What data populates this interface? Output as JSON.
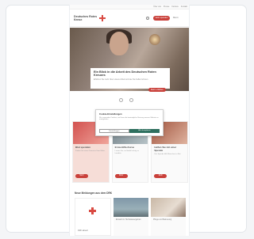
{
  "topnav": [
    "Über uns",
    "Presse",
    "Karriere",
    "Kontakt"
  ],
  "header": {
    "logo_title": "Deutsches Rotes Kreuz",
    "logo_sub": "Mein DRK",
    "donate_label": "Jetzt spenden",
    "menu_label": "Menü"
  },
  "hero": {
    "title": "Ein Blick in die Arbeit des Deutschen Roten Kreuzes",
    "text": "Erfahren Sie mehr über unsere Arbeit und wie Sie helfen können.",
    "button": "Mehr erfahren"
  },
  "cards": [
    {
      "title": "Blut spenden",
      "text": "Finden Sie einen Termin in Ihrer Nähe.",
      "button": "Mehr"
    },
    {
      "title": "Erste-Hilfe-Kurse",
      "text": "Lernen Sie, im Notfall richtig zu handeln.",
      "button": "Mehr"
    },
    {
      "title": "Helfen Sie mit einer Spende",
      "text": "Ihre Spende hilft Menschen in Not.",
      "button": "Mehr"
    }
  ],
  "cookie": {
    "title": "Cookie-Einstellungen",
    "text": "Wir verwenden Cookies, um Ihnen die bestmögliche Nutzung unserer Website zu ermöglichen.",
    "settings": "Einstellungen",
    "accept": "Alle akzeptieren"
  },
  "section": {
    "title": "Neue Meldungen aus dem DRK",
    "items": [
      {
        "text": "DRK aktuell"
      },
      {
        "text": "Einsatz im Hochwassergebiet"
      },
      {
        "text": "Pflege und Betreuung"
      }
    ]
  },
  "colors": {
    "brand_red": "#c9403a",
    "accept_green": "#2e6f5e"
  }
}
